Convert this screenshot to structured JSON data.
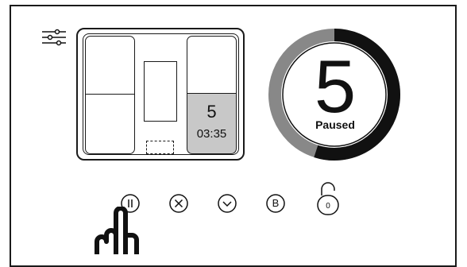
{
  "panel": {
    "active_compartment": {
      "number": "5",
      "time": "03:35"
    }
  },
  "ring": {
    "value": "5",
    "status": "Paused",
    "progress_fraction": 0.55
  },
  "controls": {
    "pause_icon": "pause-icon",
    "cancel_icon": "cancel-icon",
    "down_icon": "chevron-down-icon",
    "b_label": "B",
    "lock_label": "0"
  },
  "icons": {
    "settings": "settings-sliders-icon",
    "hand": "hand-pointer-icon"
  }
}
